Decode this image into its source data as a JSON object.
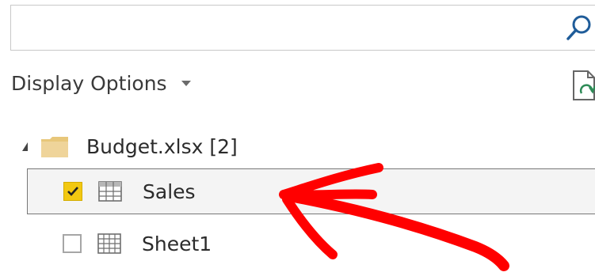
{
  "search": {
    "value": "",
    "placeholder": "",
    "icon": "search-icon"
  },
  "display_options": {
    "label": "Display Options",
    "icon": "chevron-down-icon"
  },
  "toolbar": {
    "refresh_icon": "refresh-icon"
  },
  "navigator": {
    "folder": {
      "label": "Budget.xlsx [2]",
      "expanded": true,
      "icon": "folder-icon"
    },
    "items": [
      {
        "label": "Sales",
        "checked": true,
        "selected": true,
        "icon": "table-icon"
      },
      {
        "label": "Sheet1",
        "checked": false,
        "selected": false,
        "icon": "sheet-icon"
      }
    ]
  },
  "colors": {
    "checkbox_checked": "#f2c811",
    "selection_border": "#777777",
    "folder": "#e8c77a",
    "annotation": "#ff0000",
    "refresh_accent": "#2e8b57"
  }
}
